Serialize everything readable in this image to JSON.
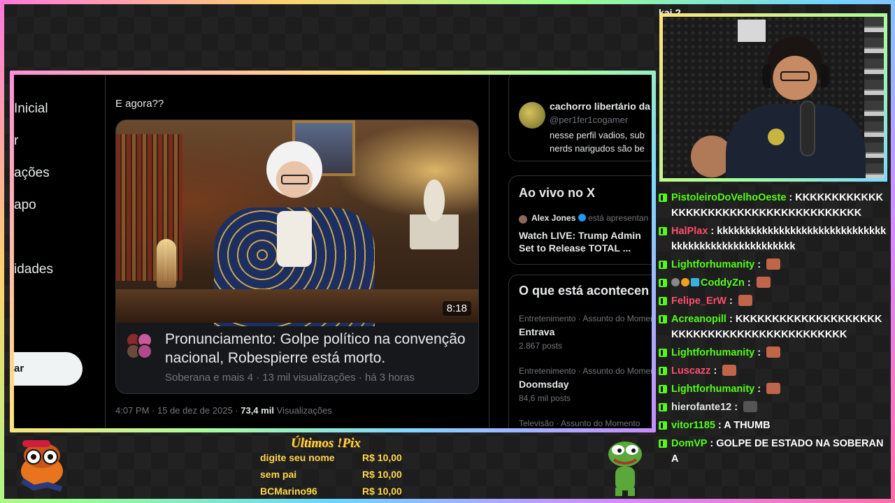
{
  "chat_top_fragment": "kai ?",
  "left_nav": {
    "items": [
      "Inicial",
      "r",
      "ações",
      "apo",
      "idades"
    ],
    "post_button": "ar"
  },
  "tweet": {
    "text": "E agora??",
    "video": {
      "duration": "8:18",
      "title": "Pronunciamento: Golpe político na convenção nacional, Robespierre está morto.",
      "meta": "Soberana e mais 4 · 13 mil visualizações · há 3 horas"
    },
    "footer_time": "4:07 PM · 15 de dez de 2025 · ",
    "footer_views_count": "73,4 mil",
    "footer_views_label": " Visualizações"
  },
  "right_sidebar": {
    "profile": {
      "name": "cachorro libertário da",
      "handle": "@per1fer1cogamer",
      "bio": "nesse perfil vadios, sub nerds narigudos são be"
    },
    "live": {
      "title": "Ao vivo no X",
      "host": "Alex Jones",
      "host_action": "está apresentan",
      "headline": "Watch LIVE: Trump Admin Set to Release TOTAL ..."
    },
    "trends": {
      "title": "O que está acontecen",
      "items": [
        {
          "context": "Entretenimento · Assunto do Momen",
          "name": "Entrava",
          "count": "2.867 posts"
        },
        {
          "context": "Entretenimento · Assunto do Momen",
          "name": "Doomsday",
          "count": "84,6 mil posts"
        },
        {
          "context": "Televisão · Assunto do Momento",
          "name": "",
          "count": ""
        }
      ]
    }
  },
  "chat": {
    "messages": [
      {
        "user": "PistoleiroDoVelhoOeste",
        "color": "#53fc18",
        "text": "KKKKKKKKKKKKKKKKKKKKKKKKKKKKKKKKKKKKKK"
      },
      {
        "user": "HalPlax",
        "color": "#ff4d6a",
        "text": "kkkkkkkkkkkkkkkkkkkkkkkkkkkkkkkkkkkkkkkkkkkkkkkkkkkk"
      },
      {
        "user": "Lightforhumanity",
        "color": "#53fc18",
        "text": "",
        "emote": "#c0644a"
      },
      {
        "user": "CoddyZn",
        "color": "#53fc18",
        "text": "",
        "emote": "#c0644a",
        "badges": true
      },
      {
        "user": "Felipe_ErW",
        "color": "#ff4d6a",
        "text": "",
        "emote": "#c0644a"
      },
      {
        "user": "Acreanopill",
        "color": "#53fc18",
        "text": "KKKKKKKKKKKKKKKKKKKKKKKKKKKKKKKKKKKKKKKKKKKK"
      },
      {
        "user": "Lightforhumanity",
        "color": "#53fc18",
        "text": "",
        "emote": "#c0644a"
      },
      {
        "user": "Luscazz",
        "color": "#ff4d6a",
        "text": "",
        "emote": "#c0644a"
      },
      {
        "user": "Lightforhumanity",
        "color": "#53fc18",
        "text": "",
        "emote": "#c0644a"
      },
      {
        "user": "hierofante12",
        "color": "#e7e9ea",
        "text": "",
        "emote": "#555555"
      },
      {
        "user": "vitor1185",
        "color": "#53fc18",
        "text": "A THUMB"
      },
      {
        "user": "DomVP",
        "color": "#53fc18",
        "text": "GOLPE DE ESTADO NA SOBERANA"
      }
    ]
  },
  "pix": {
    "title": "Últimos !Pix",
    "rows": [
      {
        "name": "digite seu nome",
        "amount": "R$ 10,00"
      },
      {
        "name": "sem pai",
        "amount": "R$ 10,00"
      },
      {
        "name": "BCMarino96",
        "amount": "R$ 10,00"
      }
    ]
  },
  "colors": {
    "kick_green": "#53fc18",
    "pix_gold": "#ffd84a",
    "x_blue_check": "#1d9bf0"
  }
}
